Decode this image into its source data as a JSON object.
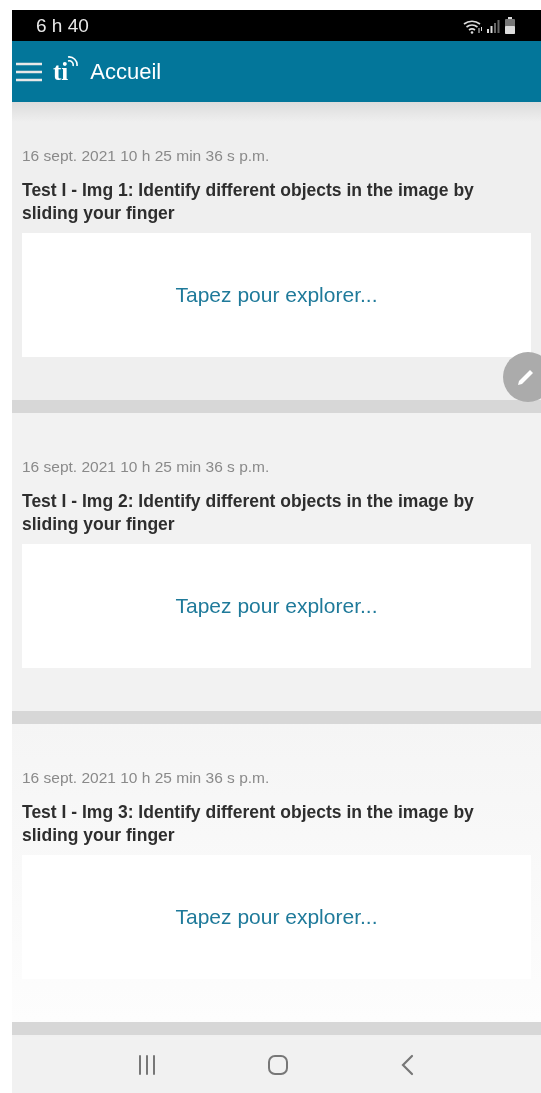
{
  "status_bar": {
    "time": "6 h 40"
  },
  "app_bar": {
    "logo_text": "ti",
    "title": "Accueil"
  },
  "cards": [
    {
      "date": "16 sept. 2021 10 h 25 min 36 s p.m.",
      "title": "Test I - Img 1: Identify different objects in the image by sliding your finger",
      "action": "Tapez pour explorer...",
      "edit_button": true
    },
    {
      "date": "16 sept. 2021 10 h 25 min 36 s p.m.",
      "title": "Test I - Img 2: Identify different objects in the image by sliding your finger",
      "action": "Tapez pour explorer...",
      "edit_button": false
    },
    {
      "date": "16 sept. 2021 10 h 25 min 36 s p.m.",
      "title": "Test I - Img 3: Identify different objects in the image by sliding your finger",
      "action": "Tapez pour explorer...",
      "edit_button": false
    }
  ]
}
